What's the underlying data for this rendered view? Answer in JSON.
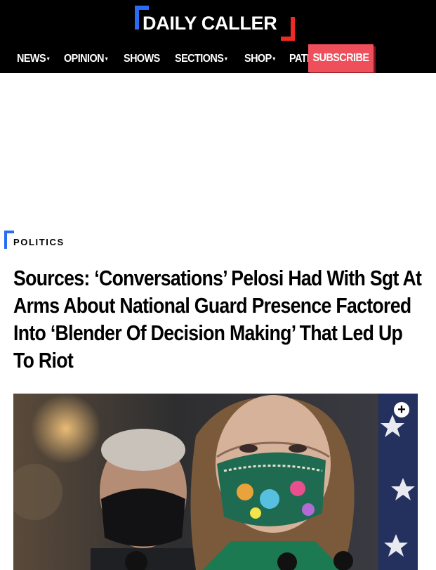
{
  "header": {
    "logo_text": "DAILY CALLER",
    "nav": [
      {
        "label": "NEWS",
        "has_dropdown": true
      },
      {
        "label": "OPINION",
        "has_dropdown": true
      },
      {
        "label": "SHOWS",
        "has_dropdown": false
      },
      {
        "label": "SECTIONS",
        "has_dropdown": true
      },
      {
        "label": "SHOP",
        "has_dropdown": true
      },
      {
        "label": "PATRIOTS",
        "has_dropdown": false
      }
    ],
    "subscribe_label": "SUBSCRIBE",
    "caret_glyph": "▾"
  },
  "article": {
    "category": "POLITICS",
    "headline": "Sources: ‘Conversations’ Pelosi Had With Sgt At Arms About National Guard Presence Factored Into ‘Blender Of Decision Making’ That Led Up To Riot",
    "image_expand_icon": "plus-circle-icon",
    "expand_glyph": "+"
  },
  "colors": {
    "header_bg": "#000000",
    "brand_blue": "#2a6df4",
    "brand_red": "#ee2a24",
    "subscribe_bg": "#ee4f5b"
  }
}
